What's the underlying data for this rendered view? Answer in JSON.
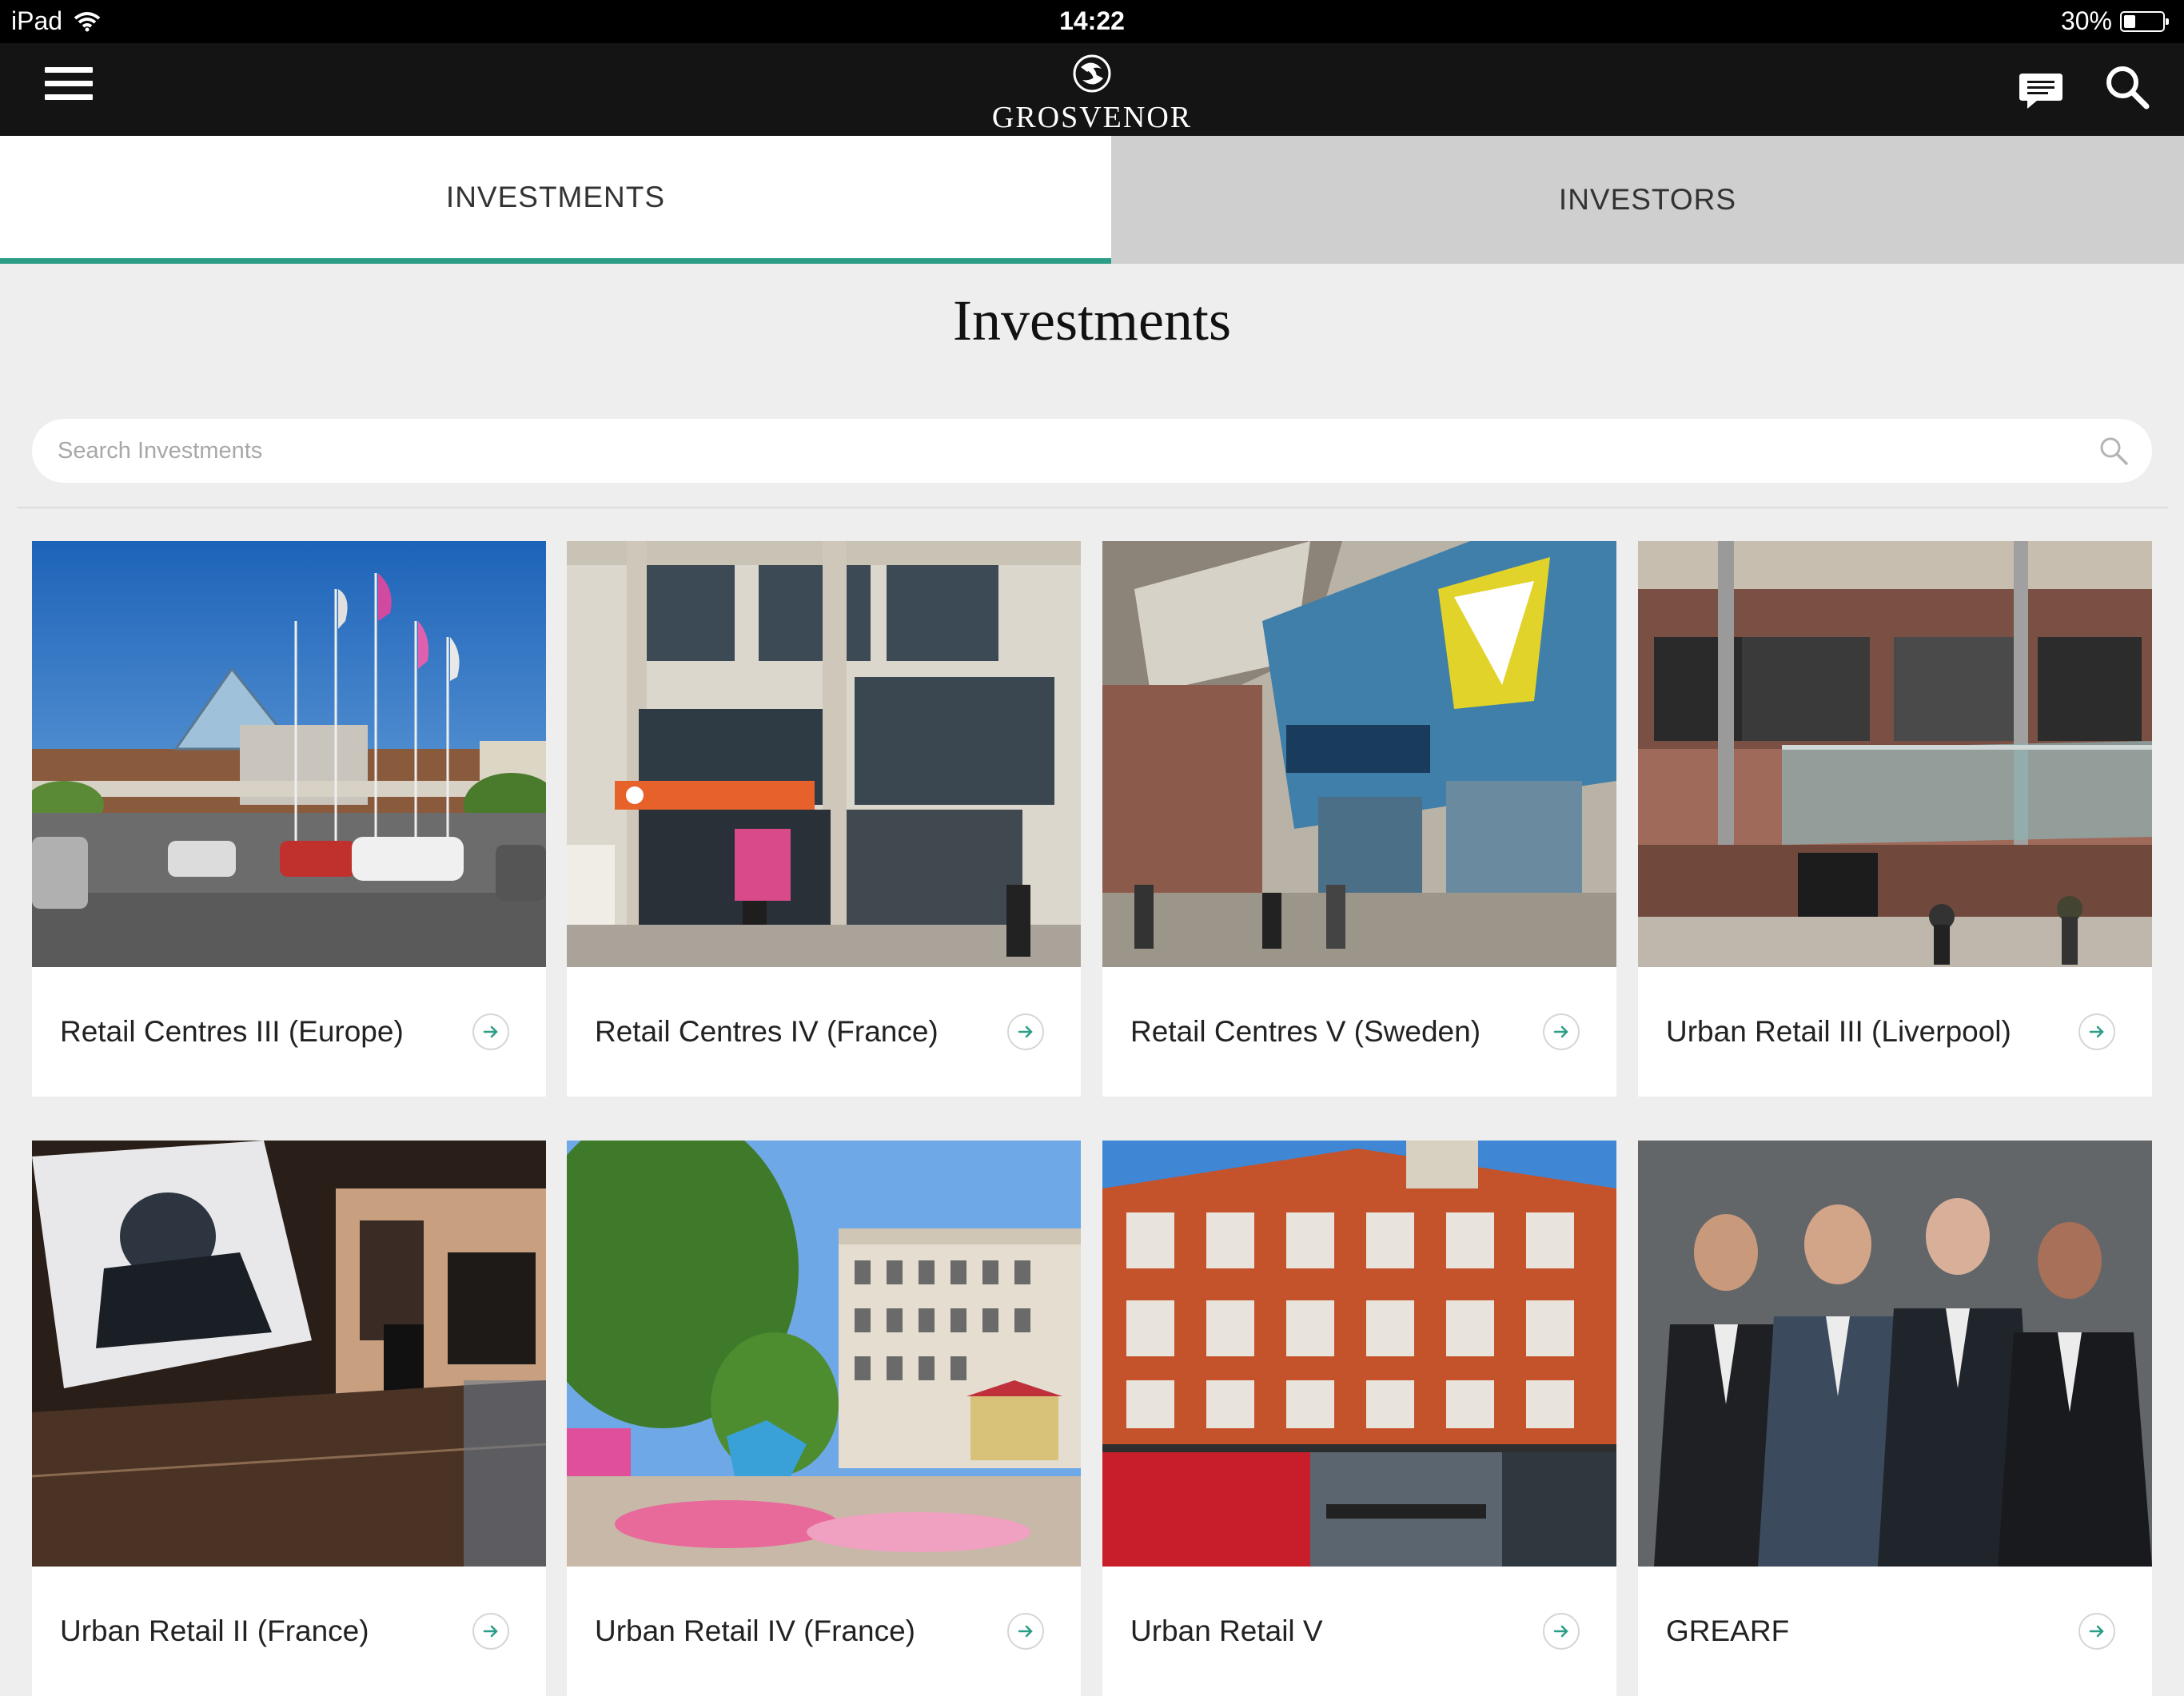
{
  "status_bar": {
    "device": "iPad",
    "time": "14:22",
    "battery": "30%",
    "battery_level": 0.3
  },
  "nav": {
    "brand": "GROSVENOR",
    "icons": [
      "menu-icon",
      "grosvenor-logo-icon",
      "chat-icon",
      "search-icon"
    ]
  },
  "tabs": [
    {
      "label": "INVESTMENTS",
      "active": true
    },
    {
      "label": "INVESTORS",
      "active": false
    }
  ],
  "page": {
    "title": "Investments"
  },
  "search": {
    "placeholder": "Search Investments",
    "value": ""
  },
  "colors": {
    "accent": "#2c9d86",
    "navbar": "#141414",
    "background": "#eeeeee"
  },
  "investments": [
    {
      "title": "Retail Centres III (Europe)"
    },
    {
      "title": "Retail Centres IV (France)"
    },
    {
      "title": "Retail Centres V (Sweden)"
    },
    {
      "title": "Urban Retail III (Liverpool)"
    },
    {
      "title": "Urban Retail II (France)"
    },
    {
      "title": "Urban Retail IV (France)"
    },
    {
      "title": "Urban Retail V"
    },
    {
      "title": "GREARF"
    }
  ]
}
